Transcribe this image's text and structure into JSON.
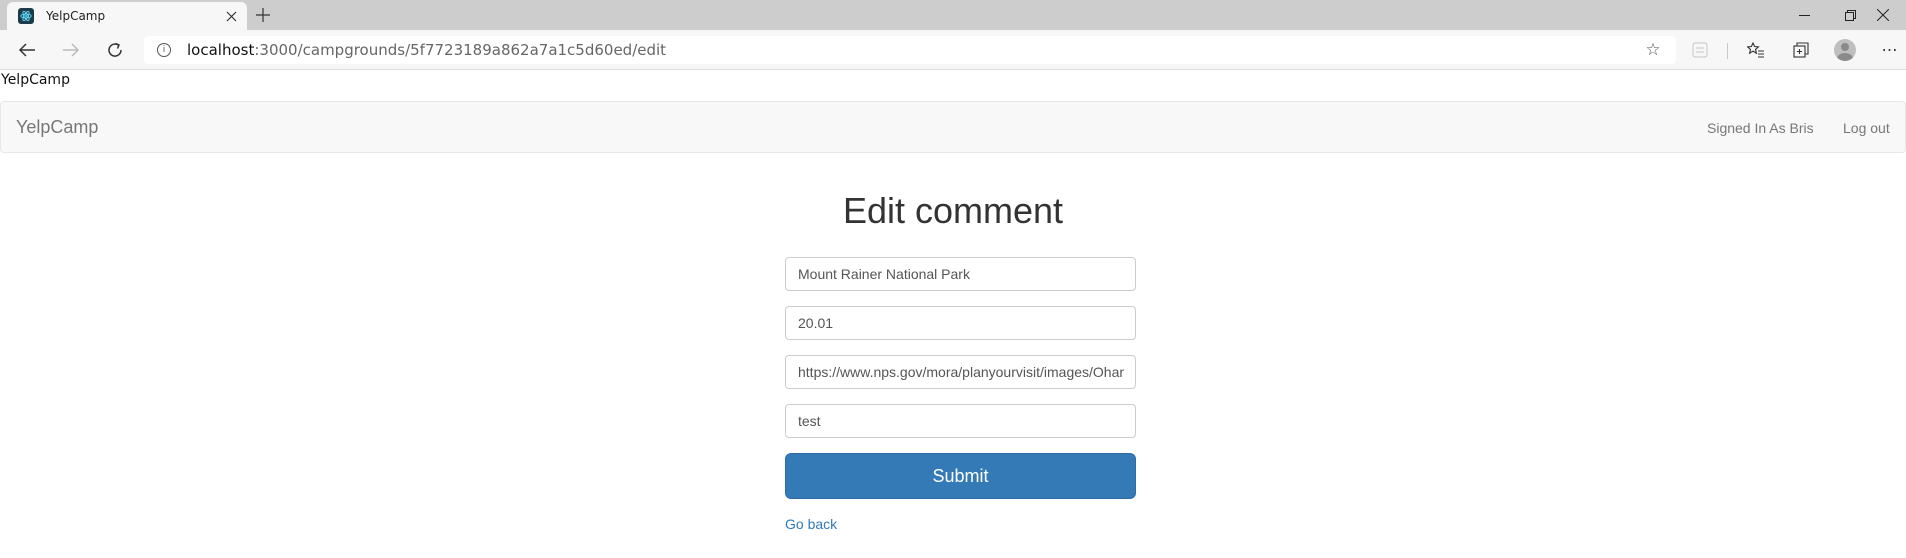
{
  "browser": {
    "tab_title": "YelpCamp",
    "url_host": "localhost",
    "url_rest": ":3000/campgrounds/5f7723189a862a7a1c5d60ed/edit"
  },
  "page_tag": "YelpCamp",
  "navbar": {
    "brand": "YelpCamp",
    "signed_in": "Signed In As Bris",
    "logout": "Log out"
  },
  "form": {
    "title": "Edit comment",
    "name_value": "Mount Rainer National Park",
    "price_value": "20.01",
    "image_value": "https://www.nps.gov/mora/planyourvisit/images/Ohar",
    "description_value": "test",
    "submit_label": "Submit",
    "back_label": "Go back"
  },
  "colors": {
    "primary": "#337ab7",
    "navbar_bg": "#f8f8f8"
  }
}
